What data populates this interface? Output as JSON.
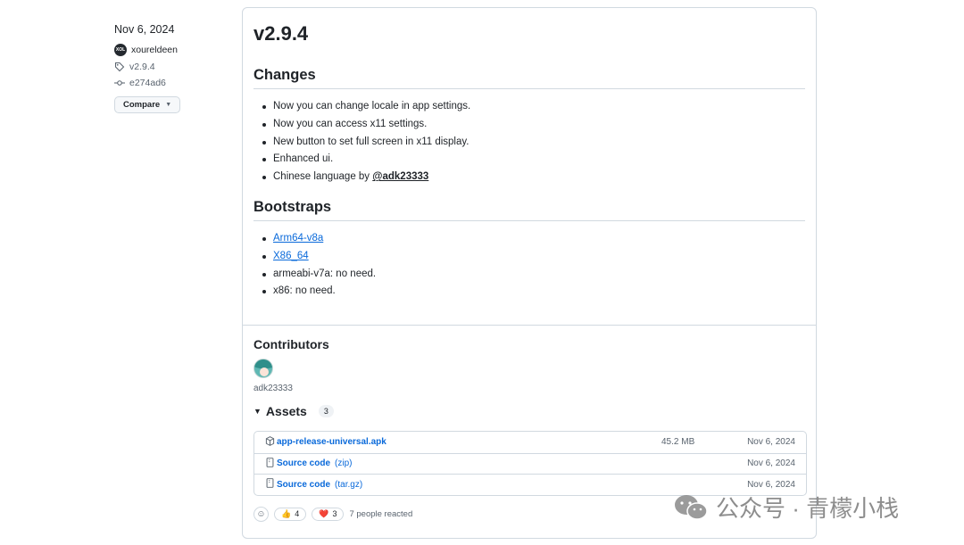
{
  "meta": {
    "date": "Nov 6, 2024",
    "author": "xoureldeen",
    "author_avatar_text": "XOL",
    "tag": "v2.9.4",
    "commit": "e274ad6",
    "compare_label": "Compare"
  },
  "release": {
    "title": "v2.9.4",
    "changes_heading": "Changes",
    "changes": [
      "Now you can change locale in app settings.",
      "Now you can access x11 settings.",
      "New button to set full screen in x11 display.",
      "Enhanced ui.",
      "Chinese language by"
    ],
    "mention": "@adk23333",
    "bootstraps_heading": "Bootstraps",
    "bootstraps": [
      "Arm64-v8a",
      "X86_64",
      "armeabi-v7a: no need.",
      "x86: no need."
    ]
  },
  "contributors": {
    "heading": "Contributors",
    "name": "adk23333"
  },
  "assets": {
    "heading": "Assets",
    "count": "3",
    "rows": [
      {
        "name": "app-release-universal.apk",
        "suffix": "",
        "size": "45.2 MB",
        "date": "Nov 6, 2024"
      },
      {
        "name": "Source code",
        "suffix": "(zip)",
        "size": "",
        "date": "Nov 6, 2024"
      },
      {
        "name": "Source code",
        "suffix": "(tar.gz)",
        "size": "",
        "date": "Nov 6, 2024"
      }
    ]
  },
  "reactions": {
    "thumbs_emoji": "👍",
    "thumbs_count": "4",
    "heart_emoji": "❤️",
    "heart_count": "3",
    "summary": "7 people reacted"
  },
  "watermark": {
    "text": "公众号 · 青檬小栈"
  },
  "colors": {
    "link": "#0969da",
    "border": "#d1d9e0",
    "muted": "#59636e"
  }
}
